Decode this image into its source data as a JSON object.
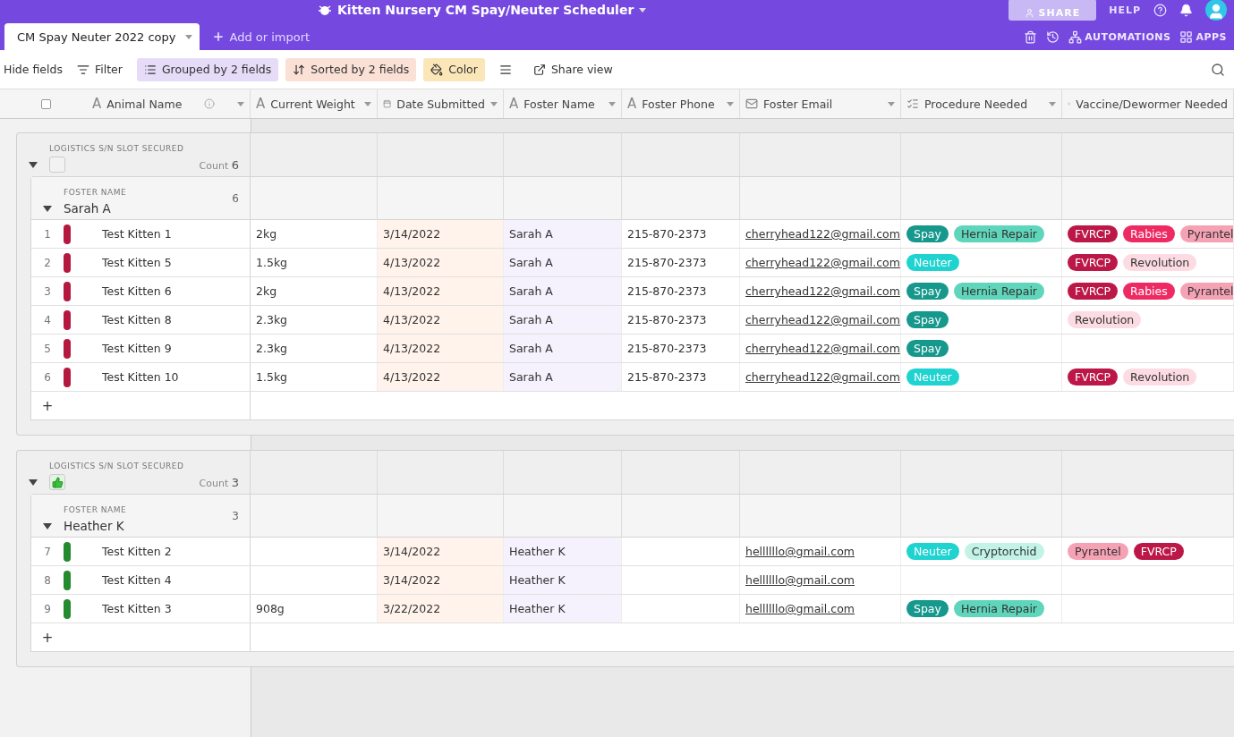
{
  "app": {
    "title": "Kitten Nursery CM Spay/Neuter Scheduler",
    "share": "SHARE",
    "help": "HELP"
  },
  "tabs": [
    {
      "label": "CM Spay Neuter 2022 copy",
      "selected": true
    }
  ],
  "add_import": "Add or import",
  "actions": [
    {
      "label": "AUTOMATIONS",
      "kind": "automations"
    },
    {
      "label": "APPS",
      "kind": "apps"
    }
  ],
  "toolbar": [
    {
      "label": "Hide fields",
      "kind": "plain"
    },
    {
      "label": "Filter",
      "kind": "filter"
    },
    {
      "label": "Grouped by 2 fields",
      "kind": "group"
    },
    {
      "label": "Sorted by 2 fields",
      "kind": "sort"
    },
    {
      "label": "Color",
      "kind": "color"
    },
    {
      "kind": "rowheight"
    },
    {
      "label": "Share view",
      "kind": "share"
    }
  ],
  "select_all": {
    "checked": false
  },
  "columns": [
    {
      "label": "Animal Name",
      "kind": "text",
      "glyph": "A"
    },
    {
      "label": "Current Weight",
      "kind": "text",
      "glyph": "A"
    },
    {
      "label": "Date Submitted",
      "kind": "date"
    },
    {
      "label": "Foster Name",
      "kind": "text",
      "glyph": "A"
    },
    {
      "label": "Foster Phone",
      "kind": "text",
      "glyph": "A"
    },
    {
      "label": "Foster Email",
      "kind": "email"
    },
    {
      "label": "Procedure Needed",
      "kind": "multi"
    },
    {
      "label": "Vaccine/Dewormer Needed",
      "kind": "multi"
    }
  ],
  "groups": [
    {
      "label": "LOGISTICS S/N SLOT SECURED",
      "checked": false,
      "count_label": "Count",
      "count": "6",
      "subgroups": [
        {
          "label": "FOSTER NAME",
          "name": "Sarah A",
          "count": "6",
          "add_row": "+",
          "rows": [
            {
              "num": "1",
              "color": "#b5183f",
              "name": "Test Kitten 1",
              "weight": "2kg",
              "date": "3/14/2022",
              "foster": "Sarah A",
              "phone": "215-870-2373",
              "email": "cherryhead122@gmail.com",
              "procedures": [
                {
                  "label": "Spay",
                  "color": "#16988c"
                },
                {
                  "label": "Hernia Repair",
                  "color": "#5fd6bb"
                }
              ],
              "vaccines": [
                {
                  "label": "FVRCP",
                  "color": "#bb1848"
                },
                {
                  "label": "Rabies",
                  "color": "#ee2a63"
                },
                {
                  "label": "Pyrantel",
                  "color": "#f6a2b5"
                }
              ]
            },
            {
              "num": "2",
              "color": "#b5183f",
              "name": "Test Kitten 5",
              "weight": "1.5kg",
              "date": "4/13/2022",
              "foster": "Sarah A",
              "phone": "215-870-2373",
              "email": "cherryhead122@gmail.com",
              "procedures": [
                {
                  "label": "Neuter",
                  "color": "#1ed3d0"
                }
              ],
              "vaccines": [
                {
                  "label": "FVRCP",
                  "color": "#bb1848"
                },
                {
                  "label": "Revolution",
                  "color": "#fcdbe3"
                }
              ]
            },
            {
              "num": "3",
              "color": "#b5183f",
              "name": "Test Kitten 6",
              "weight": "2kg",
              "date": "4/13/2022",
              "foster": "Sarah A",
              "phone": "215-870-2373",
              "email": "cherryhead122@gmail.com",
              "procedures": [
                {
                  "label": "Spay",
                  "color": "#16988c"
                },
                {
                  "label": "Hernia Repair",
                  "color": "#5fd6bb"
                }
              ],
              "vaccines": [
                {
                  "label": "FVRCP",
                  "color": "#bb1848"
                },
                {
                  "label": "Rabies",
                  "color": "#ee2a63"
                },
                {
                  "label": "Pyrantel",
                  "color": "#f6a2b5"
                }
              ]
            },
            {
              "num": "4",
              "color": "#b5183f",
              "name": "Test Kitten 8",
              "weight": "2.3kg",
              "date": "4/13/2022",
              "foster": "Sarah A",
              "phone": "215-870-2373",
              "email": "cherryhead122@gmail.com",
              "procedures": [
                {
                  "label": "Spay",
                  "color": "#16988c"
                }
              ],
              "vaccines": [
                {
                  "label": "Revolution",
                  "color": "#fcdbe3"
                }
              ]
            },
            {
              "num": "5",
              "color": "#b5183f",
              "name": "Test Kitten 9",
              "weight": "2.3kg",
              "date": "4/13/2022",
              "foster": "Sarah A",
              "phone": "215-870-2373",
              "email": "cherryhead122@gmail.com",
              "procedures": [
                {
                  "label": "Spay",
                  "color": "#16988c"
                }
              ]
            },
            {
              "num": "6",
              "color": "#b5183f",
              "name": "Test Kitten 10",
              "weight": "1.5kg",
              "date": "4/13/2022",
              "foster": "Sarah A",
              "phone": "215-870-2373",
              "email": "cherryhead122@gmail.com",
              "procedures": [
                {
                  "label": "Neuter",
                  "color": "#1ed3d0"
                }
              ],
              "vaccines": [
                {
                  "label": "FVRCP",
                  "color": "#bb1848"
                },
                {
                  "label": "Revolution",
                  "color": "#fcdbe3"
                }
              ]
            }
          ]
        }
      ]
    },
    {
      "label": "LOGISTICS S/N SLOT SECURED",
      "checked": true,
      "count_label": "Count",
      "count": "3",
      "subgroups": [
        {
          "label": "FOSTER NAME",
          "name": "Heather K",
          "count": "3",
          "add_row": "+",
          "rows": [
            {
              "num": "7",
              "color": "#238a2e",
              "name": "Test Kitten 2",
              "date": "3/14/2022",
              "foster": "Heather K",
              "email": "hellllllo@gmail.com",
              "procedures": [
                {
                  "label": "Neuter",
                  "color": "#1ed3d0"
                },
                {
                  "label": "Cryptorchid",
                  "color": "#c2f3e6"
                }
              ],
              "vaccines": [
                {
                  "label": "Pyrantel",
                  "color": "#f6a2b5"
                },
                {
                  "label": "FVRCP",
                  "color": "#bb1848"
                }
              ]
            },
            {
              "num": "8",
              "color": "#238a2e",
              "name": "Test Kitten 4",
              "date": "3/14/2022",
              "foster": "Heather K",
              "email": "hellllllo@gmail.com"
            },
            {
              "num": "9",
              "color": "#238a2e",
              "name": "Test Kitten 3",
              "weight": "908g",
              "date": "3/22/2022",
              "foster": "Heather K",
              "email": "hellllllo@gmail.com",
              "procedures": [
                {
                  "label": "Spay",
                  "color": "#16988c"
                },
                {
                  "label": "Hernia Repair",
                  "color": "#5fd6bb"
                }
              ]
            }
          ]
        }
      ]
    }
  ]
}
